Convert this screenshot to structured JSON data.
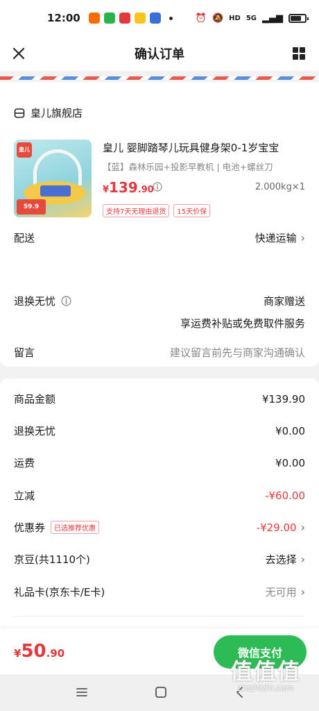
{
  "status_bar": {
    "time": "12:00",
    "network": "5G",
    "hd": "HD"
  },
  "nav": {
    "title": "确认订单"
  },
  "store": {
    "name": "皇儿旗舰店"
  },
  "product": {
    "title": "皇儿 婴脚踏琴儿玩具健身架0-1岁宝宝",
    "spec": "【蓝】森林乐园+投影早教机 | 电池+螺丝刀",
    "price_currency": "¥",
    "price_int": "139",
    "price_dec": ".90",
    "weight_qty": "2.000kg×1",
    "tags": [
      "支持7天无理由退货",
      "15天价保"
    ],
    "thumb_brand": "皇儿",
    "thumb_tag": "59.9"
  },
  "delivery": {
    "label": "配送",
    "value": "快递运输"
  },
  "return_worry": {
    "label": "退换无忧",
    "value": "商家赠送",
    "sub": "享运费补贴或免费取件服务"
  },
  "message": {
    "label": "留言",
    "placeholder": "建议留言前先与商家沟通确认"
  },
  "summary": [
    {
      "label": "商品金额",
      "value": "¥139.90",
      "style": "normal"
    },
    {
      "label": "退换无忧",
      "value": "¥0.00",
      "style": "normal"
    },
    {
      "label": "运费",
      "value": "¥0.00",
      "style": "normal"
    },
    {
      "label": "立减",
      "value": "-¥60.00",
      "style": "red"
    },
    {
      "label": "优惠券",
      "value": "-¥29.00",
      "style": "red",
      "badge": "已选推荐优惠"
    },
    {
      "label": "京豆(共1110个)",
      "value": "去选择",
      "style": "normal"
    },
    {
      "label": "礼品卡(京东卡/E卡)",
      "value": "无可用",
      "style": "gray"
    }
  ],
  "bottom": {
    "currency": "¥",
    "total_int": "50",
    "total_dec": ".90",
    "pay_label": "微信支付"
  },
  "watermark": {
    "big": "值值值",
    "small": "zhizhizhi.com"
  }
}
